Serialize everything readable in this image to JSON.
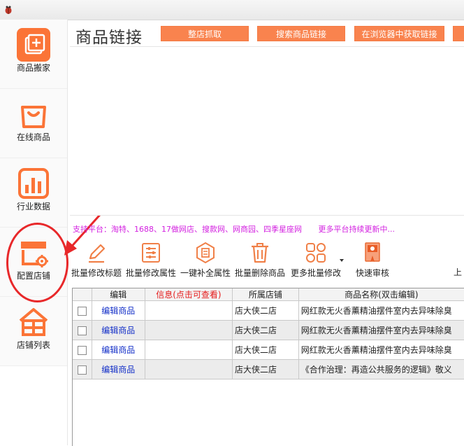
{
  "sidebar": {
    "items": [
      {
        "label": "商品搬家",
        "icon": "plus-box-icon"
      },
      {
        "label": "在线商品",
        "icon": "shopping-bag-icon"
      },
      {
        "label": "行业数据",
        "icon": "bar-chart-icon"
      },
      {
        "label": "配置店铺",
        "icon": "store-settings-icon"
      },
      {
        "label": "店铺列表",
        "icon": "store-list-icon"
      }
    ]
  },
  "header": {
    "title": "商品链接",
    "buttons": [
      "整店抓取",
      "搜索商品链接",
      "在浏览器中获取链接"
    ]
  },
  "platforms": {
    "text": "支持平台：淘特、1688、17做网店、搜款网、网商园、四季星座网",
    "more": "更多平台持续更新中..."
  },
  "toolbar": {
    "items": [
      {
        "label": "批量修改标题",
        "icon": "pencil-icon"
      },
      {
        "label": "批量修改属性",
        "icon": "sliders-icon"
      },
      {
        "label": "一键补全属性",
        "icon": "hexagon-document-icon"
      },
      {
        "label": "批量删除商品",
        "icon": "trash-icon"
      },
      {
        "label": "更多批量修改",
        "icon": "grid-shapes-icon"
      },
      {
        "label": "快速审核",
        "icon": "book-check-icon"
      }
    ],
    "truncated_label": "上"
  },
  "table": {
    "headers": [
      "编辑",
      "信息(点击可查看)",
      "所属店铺",
      "商品名称(双击编辑)"
    ],
    "rows": [
      {
        "edit": "编辑商品",
        "info": "",
        "shop": "店大侠二店",
        "name": "网红款无火香薰精油摆件室内去异味除臭"
      },
      {
        "edit": "编辑商品",
        "info": "",
        "shop": "店大侠二店",
        "name": "网红款无火香薰精油摆件室内去异味除臭"
      },
      {
        "edit": "编辑商品",
        "info": "",
        "shop": "店大侠二店",
        "name": "网红款无火香薰精油摆件室内去异味除臭"
      },
      {
        "edit": "编辑商品",
        "info": "",
        "shop": "店大侠二店",
        "name": "《合作治理：再造公共服务的逻辑》敬义"
      }
    ]
  },
  "colors": {
    "accent": "#fb7437",
    "platform_text": "#d321e0",
    "info_header": "#e51b1b",
    "edit_link": "#1430c8",
    "annotation": "#e8282a"
  }
}
